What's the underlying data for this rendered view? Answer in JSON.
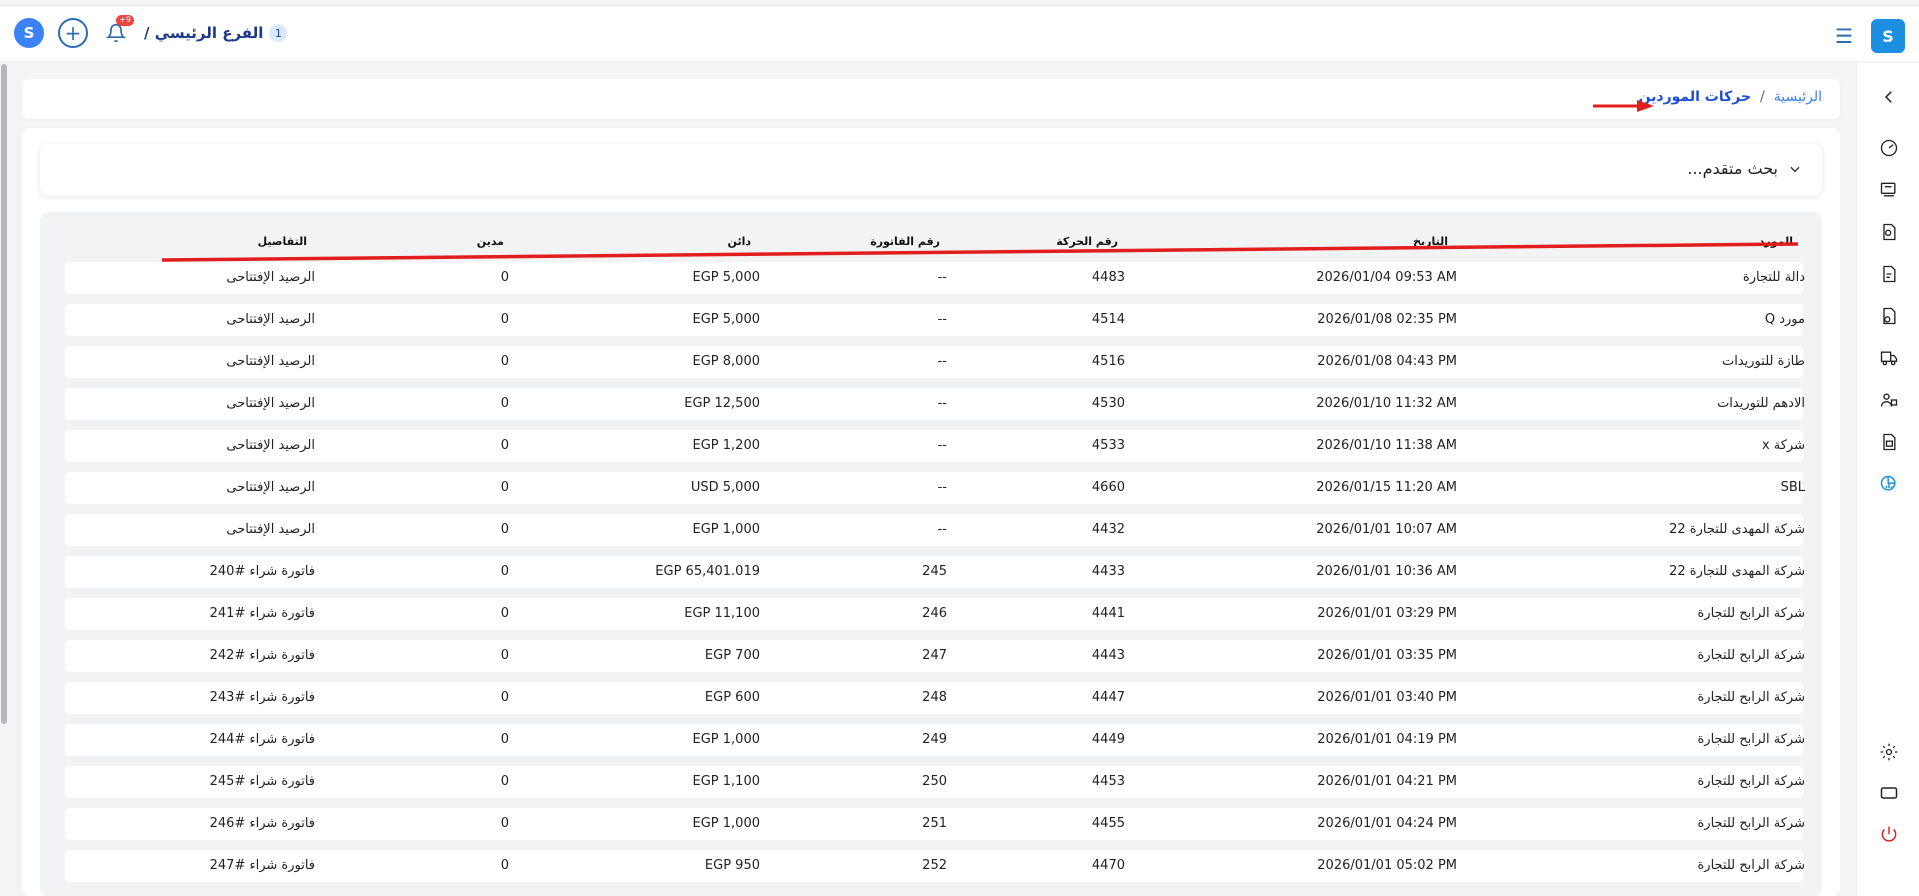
{
  "topbar": {
    "branch_name": "الفرع الرئيسي /",
    "branch_number": "1",
    "notification_badge": "+9"
  },
  "breadcrumb": {
    "home": "الرئيسية",
    "separator": "/",
    "current": "حركات الموردين"
  },
  "advanced_search": {
    "label": "بحث متقدم..."
  },
  "table": {
    "headers": {
      "supplier": "المورد",
      "date": "التاريخ",
      "movement_no": "رقم الحركة",
      "invoice_no": "رقم الفاتورة",
      "credit": "دائن",
      "debit": "مدين",
      "details": "التفاصيل"
    },
    "rows": [
      {
        "supplier": "دالة للتجارة",
        "date": "2026/01/04 09:53 AM",
        "movement_no": "4483",
        "invoice_no": "--",
        "credit": "EGP 5,000",
        "debit": "0",
        "details": "الرصيد الإفتتاحى"
      },
      {
        "supplier": "مورد Q",
        "date": "2026/01/08 02:35 PM",
        "movement_no": "4514",
        "invoice_no": "--",
        "credit": "EGP 5,000",
        "debit": "0",
        "details": "الرصيد الإفتتاحى"
      },
      {
        "supplier": "طازة للتوريدات",
        "date": "2026/01/08 04:43 PM",
        "movement_no": "4516",
        "invoice_no": "--",
        "credit": "EGP 8,000",
        "debit": "0",
        "details": "الرصيد الإفتتاحى"
      },
      {
        "supplier": "الادهم للتوريدات",
        "date": "2026/01/10 11:32 AM",
        "movement_no": "4530",
        "invoice_no": "--",
        "credit": "EGP 12,500",
        "debit": "0",
        "details": "الرصيد الإفتتاحى"
      },
      {
        "supplier": "شركة x",
        "date": "2026/01/10 11:38 AM",
        "movement_no": "4533",
        "invoice_no": "--",
        "credit": "EGP 1,200",
        "debit": "0",
        "details": "الرصيد الإفتتاحى"
      },
      {
        "supplier": "SBL",
        "date": "2026/01/15 11:20 AM",
        "movement_no": "4660",
        "invoice_no": "--",
        "credit": "USD 5,000",
        "debit": "0",
        "details": "الرصيد الإفتتاحى"
      },
      {
        "supplier": "شركة المهدى للتجارة 22",
        "date": "2026/01/01 10:07 AM",
        "movement_no": "4432",
        "invoice_no": "--",
        "credit": "EGP 1,000",
        "debit": "0",
        "details": "الرصيد الإفتتاحى"
      },
      {
        "supplier": "شركة المهدى للتجارة 22",
        "date": "2026/01/01 10:36 AM",
        "movement_no": "4433",
        "invoice_no": "245",
        "credit": "EGP 65,401.019",
        "debit": "0",
        "details": "فاتورة شراء #240"
      },
      {
        "supplier": "شركة الرابح للتجارة",
        "date": "2026/01/01 03:29 PM",
        "movement_no": "4441",
        "invoice_no": "246",
        "credit": "EGP 11,100",
        "debit": "0",
        "details": "فاتورة شراء #241"
      },
      {
        "supplier": "شركة الرابح للتجارة",
        "date": "2026/01/01 03:35 PM",
        "movement_no": "4443",
        "invoice_no": "247",
        "credit": "EGP 700",
        "debit": "0",
        "details": "فاتورة شراء #242"
      },
      {
        "supplier": "شركة الرابح للتجارة",
        "date": "2026/01/01 03:40 PM",
        "movement_no": "4447",
        "invoice_no": "248",
        "credit": "EGP 600",
        "debit": "0",
        "details": "فاتورة شراء #243"
      },
      {
        "supplier": "شركة الرابح للتجارة",
        "date": "2026/01/01 04:19 PM",
        "movement_no": "4449",
        "invoice_no": "249",
        "credit": "EGP 1,000",
        "debit": "0",
        "details": "فاتورة شراء #244"
      },
      {
        "supplier": "شركة الرابح للتجارة",
        "date": "2026/01/01 04:21 PM",
        "movement_no": "4453",
        "invoice_no": "250",
        "credit": "EGP 1,100",
        "debit": "0",
        "details": "فاتورة شراء #245"
      },
      {
        "supplier": "شركة الرابح للتجارة",
        "date": "2026/01/01 04:24 PM",
        "movement_no": "4455",
        "invoice_no": "251",
        "credit": "EGP 1,000",
        "debit": "0",
        "details": "فاتورة شراء #246"
      },
      {
        "supplier": "شركة الرابح للتجارة",
        "date": "2026/01/01 05:02 PM",
        "movement_no": "4470",
        "invoice_no": "252",
        "credit": "EGP 950",
        "debit": "0",
        "details": "فاتورة شراء #247"
      }
    ]
  },
  "sidebar": {
    "icons": [
      "chevron-left-icon",
      "dashboard-icon",
      "pos-icon",
      "search-doc-icon",
      "invoice-icon",
      "purchase-icon",
      "delivery-icon",
      "users-icon",
      "accounting-icon",
      "reports-icon",
      "settings-icon",
      "screen-icon",
      "power-icon"
    ]
  },
  "colors": {
    "accent": "#1d8fe1",
    "link": "#3b82f6",
    "annotation_red": "#e11d1d"
  }
}
